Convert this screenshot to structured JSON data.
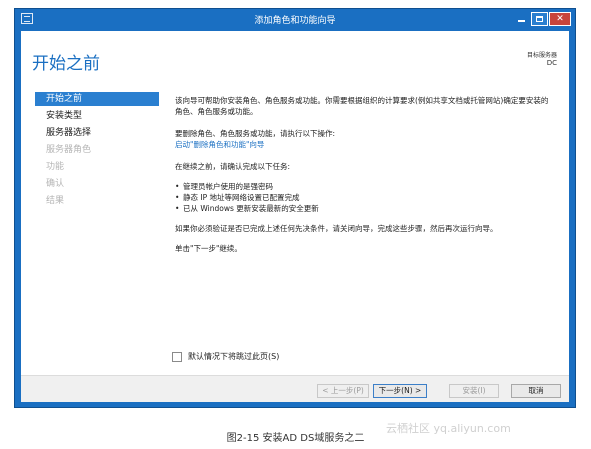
{
  "window": {
    "title": "添加角色和功能向导",
    "controls": {
      "minimize": "minimize-icon",
      "maximize": "maximize-icon",
      "close": "close-icon",
      "close_glyph": "✕"
    }
  },
  "header": {
    "page_title": "开始之前",
    "target_label": "目标服务器",
    "target_value": "DC"
  },
  "nav": {
    "items": [
      {
        "label": "开始之前",
        "state": "active"
      },
      {
        "label": "安装类型",
        "state": "enabled"
      },
      {
        "label": "服务器选择",
        "state": "enabled"
      },
      {
        "label": "服务器角色",
        "state": "disabled"
      },
      {
        "label": "功能",
        "state": "disabled"
      },
      {
        "label": "确认",
        "state": "disabled"
      },
      {
        "label": "结果",
        "state": "disabled"
      }
    ]
  },
  "main": {
    "intro": "该向导可帮助你安装角色、角色服务或功能。你需要根据组织的计算要求(例如共享文档或托管网站)确定要安装的角色、角色服务或功能。",
    "remove_prompt": "要删除角色、角色服务或功能，请执行以下操作:",
    "remove_link": "启动\"删除角色和功能\"向导",
    "before_continue": "在继续之前，请确认完成以下任务:",
    "tasks": [
      "管理员帐户使用的是强密码",
      "静态 IP 地址等网络设置已配置完成",
      "已从 Windows 更新安装最新的安全更新"
    ],
    "verify_text": "如果你必须验证是否已完成上述任何先决条件，请关闭向导，完成这些步骤，然后再次运行向导。",
    "click_next": "单击\"下一步\"继续。",
    "skip_checkbox": "默认情况下将跳过此页(S)"
  },
  "footer": {
    "prev": "< 上一步(P)",
    "next": "下一步(N) >",
    "install": "安装(I)",
    "cancel": "取消"
  },
  "caption": "图2-15 安装AD DS域服务之二",
  "watermark": "云栖社区 yq.aliyun.com",
  "colors": {
    "window_frame": "#1a6fc2",
    "title_accent": "#1a6fc2",
    "nav_active": "#2a7fd0",
    "close_button": "#c7453c"
  }
}
